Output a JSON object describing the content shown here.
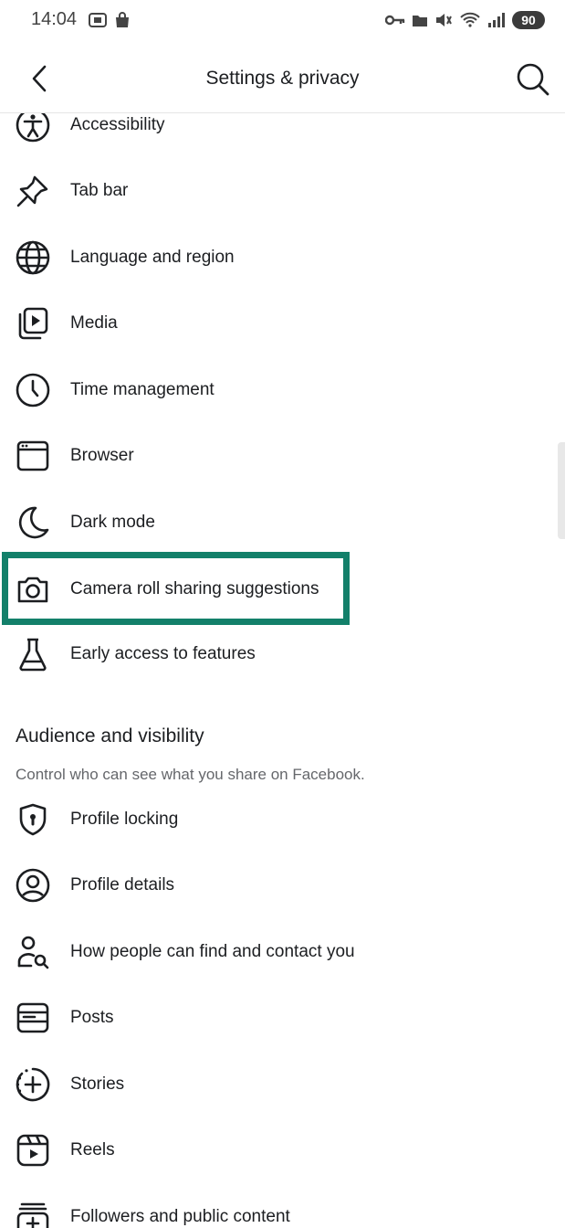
{
  "status_bar": {
    "time": "14:04",
    "battery": "90"
  },
  "header": {
    "title": "Settings & privacy"
  },
  "preferences": [
    {
      "label": "Accessibility",
      "icon": "accessibility-icon"
    },
    {
      "label": "Tab bar",
      "icon": "pin-icon"
    },
    {
      "label": "Language and region",
      "icon": "globe-icon"
    },
    {
      "label": "Media",
      "icon": "media-icon"
    },
    {
      "label": "Time management",
      "icon": "clock-icon"
    },
    {
      "label": "Browser",
      "icon": "browser-icon"
    },
    {
      "label": "Dark mode",
      "icon": "moon-icon"
    },
    {
      "label": "Camera roll sharing suggestions",
      "icon": "camera-icon"
    },
    {
      "label": "Early access to features",
      "icon": "flask-icon"
    }
  ],
  "audience": {
    "title": "Audience and visibility",
    "subtitle": "Control who can see what you share on Facebook.",
    "items": [
      {
        "label": "Profile locking",
        "icon": "shield-lock-icon"
      },
      {
        "label": "Profile details",
        "icon": "profile-circle-icon"
      },
      {
        "label": "How people can find and contact you",
        "icon": "person-search-icon"
      },
      {
        "label": "Posts",
        "icon": "posts-icon"
      },
      {
        "label": "Stories",
        "icon": "stories-icon"
      },
      {
        "label": "Reels",
        "icon": "reels-icon"
      },
      {
        "label": "Followers and public content",
        "icon": "followers-icon"
      }
    ]
  },
  "colors": {
    "highlight": "#13806a",
    "text": "#1c1e21",
    "secondary": "#65676b"
  }
}
